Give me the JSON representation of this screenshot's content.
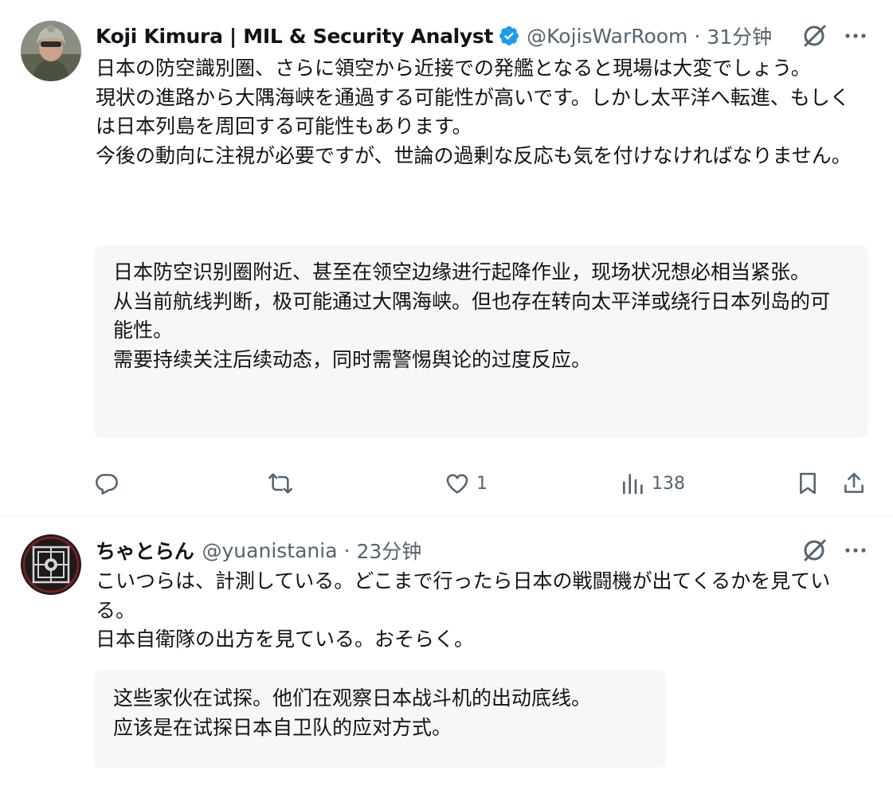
{
  "posts": [
    {
      "author_name": "Koji Kimura | MIL & Security Analyst",
      "verified": true,
      "handle": "@KojisWarRoom",
      "separator": "·",
      "time": "31分钟",
      "body_lines": [
        "日本の防空識別圏、さらに領空から近接での発艦となると現場は大変でしょう。",
        "現状の進路から大隅海峡を通過する可能性が高いです。しかし太平洋へ転進、もしくは日本列島を周回する可能性もあります。",
        "今後の動向に注視が必要ですが、世論の過剰な反応も気を付けなければなりません。"
      ],
      "translation_lines": [
        "日本防空识别圈附近、甚至在领空边缘进行起降作业，现场状况想必相当紧张。",
        "从当前航线判断，极可能通过大隅海峡。但也存在转向太平洋或绕行日本列岛的可能性。",
        "需要持续关注后续动态，同时需警惕舆论的过度反应。"
      ],
      "actions": {
        "reply": "",
        "repost": "",
        "like": "1",
        "views": "138"
      }
    },
    {
      "author_name": "ちゃとらん",
      "verified": false,
      "handle": "@yuanistania",
      "separator": "·",
      "time": "23分钟",
      "body_lines": [
        "こいつらは、計測している。どこまで行ったら日本の戦闘機が出てくるかを見ている。",
        "日本自衛隊の出方を見ている。おそらく。"
      ],
      "translation_lines": [
        "这些家伙在试探。他们在观察日本战斗机的出动底线。",
        "应该是在试探日本自卫队的应对方式。"
      ]
    }
  ],
  "colors": {
    "text_primary": "#0f1419",
    "text_secondary": "#536471",
    "verified_blue": "#1d9bf0",
    "translation_bg": "#f7f7f7",
    "divider": "#eff3f4"
  },
  "icons": [
    "verified-badge-icon",
    "grok-icon",
    "more-icon",
    "reply-icon",
    "repost-icon",
    "like-icon",
    "views-icon",
    "bookmark-icon",
    "share-icon"
  ]
}
